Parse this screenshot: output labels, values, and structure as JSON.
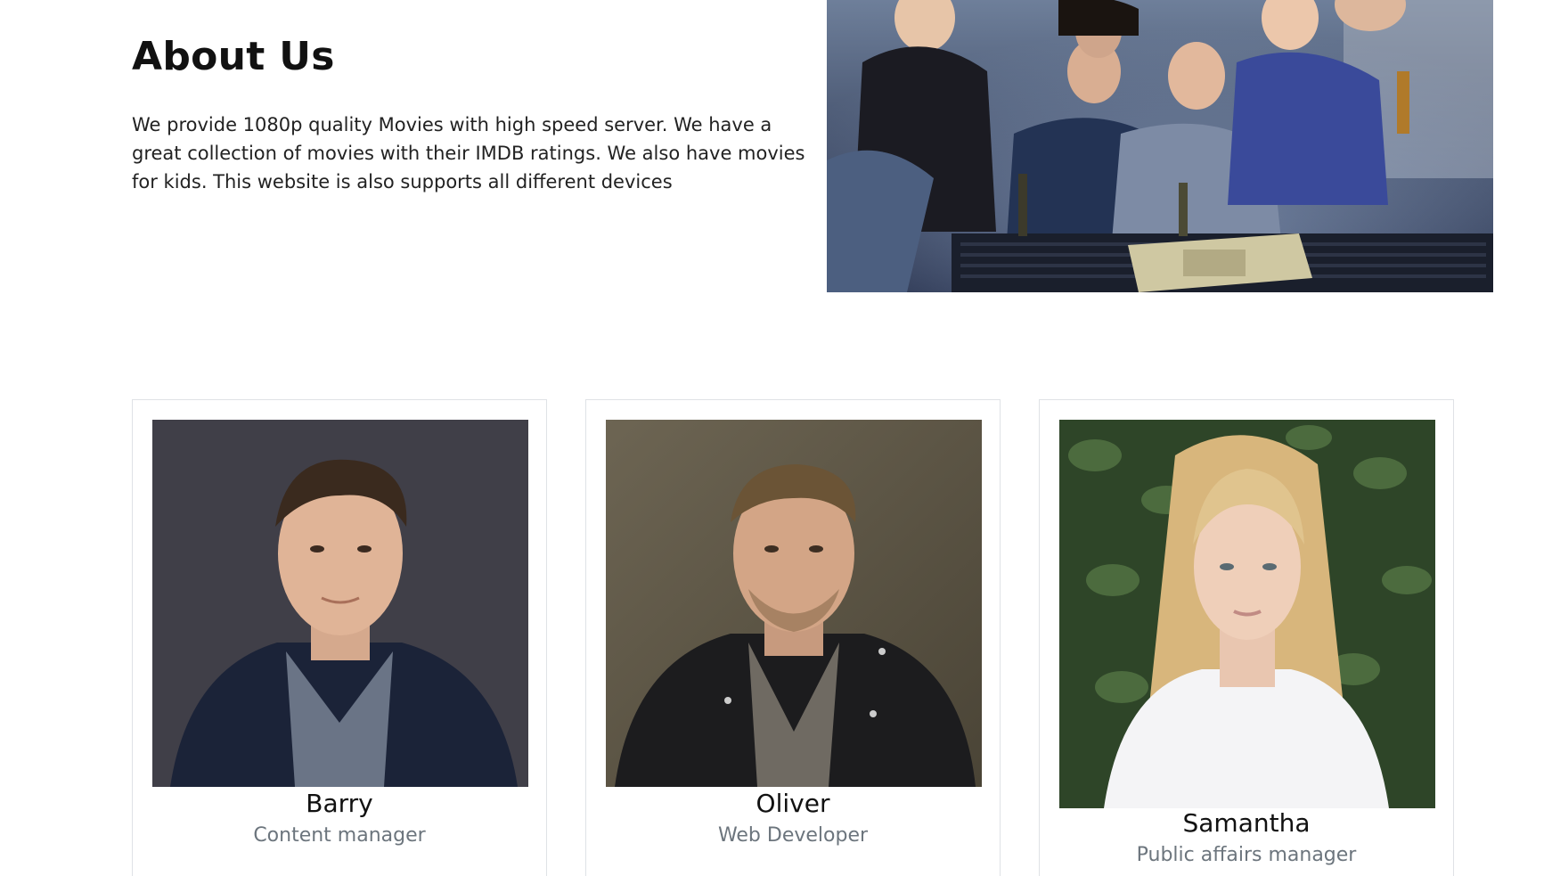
{
  "about": {
    "title": "About Us",
    "text": "We provide 1080p quality Movies with high speed server. We have a great collection of movies with their IMDB ratings. We also have movies for kids. This website is also supports all different devices"
  },
  "team": [
    {
      "name": "Barry",
      "role": "Content manager"
    },
    {
      "name": "Oliver",
      "role": "Web Developer"
    },
    {
      "name": "Samantha",
      "role": "Public affairs manager"
    }
  ],
  "colors": {
    "text": "#212529",
    "muted": "#6c757d",
    "card_border": "#dfe2e6"
  }
}
